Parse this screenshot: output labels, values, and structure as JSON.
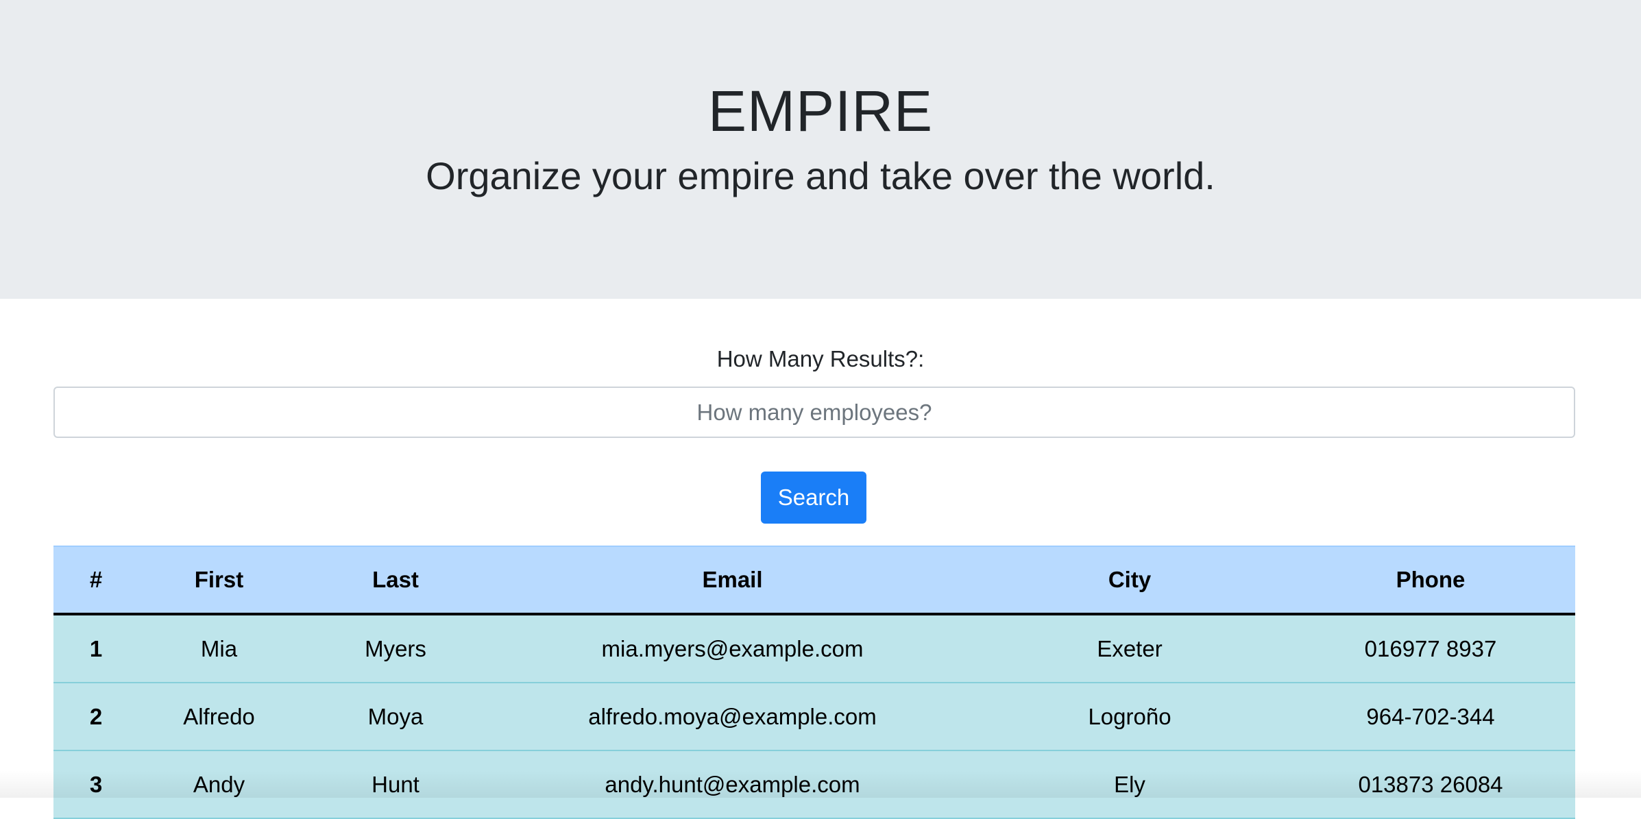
{
  "header": {
    "title": "EMPIRE",
    "tagline": "Organize your empire and take over the world."
  },
  "search": {
    "label": "How Many Results?:",
    "placeholder": "How many employees?",
    "value": "",
    "button_label": "Search"
  },
  "table": {
    "columns": [
      "#",
      "First",
      "Last",
      "Email",
      "City",
      "Phone"
    ],
    "rows": [
      {
        "index": "1",
        "first": "Mia",
        "last": "Myers",
        "email": "mia.myers@example.com",
        "city": "Exeter",
        "phone": "016977 8937"
      },
      {
        "index": "2",
        "first": "Alfredo",
        "last": "Moya",
        "email": "alfredo.moya@example.com",
        "city": "Logroño",
        "phone": "964-702-344"
      },
      {
        "index": "3",
        "first": "Andy",
        "last": "Hunt",
        "email": "andy.hunt@example.com",
        "city": "Ely",
        "phone": "013873 26084"
      }
    ]
  },
  "colors": {
    "header_bg": "#e9ecef",
    "button_bg": "#1a7ef7",
    "table_head_bg": "#b8daff",
    "table_row_bg": "#bee5eb"
  }
}
